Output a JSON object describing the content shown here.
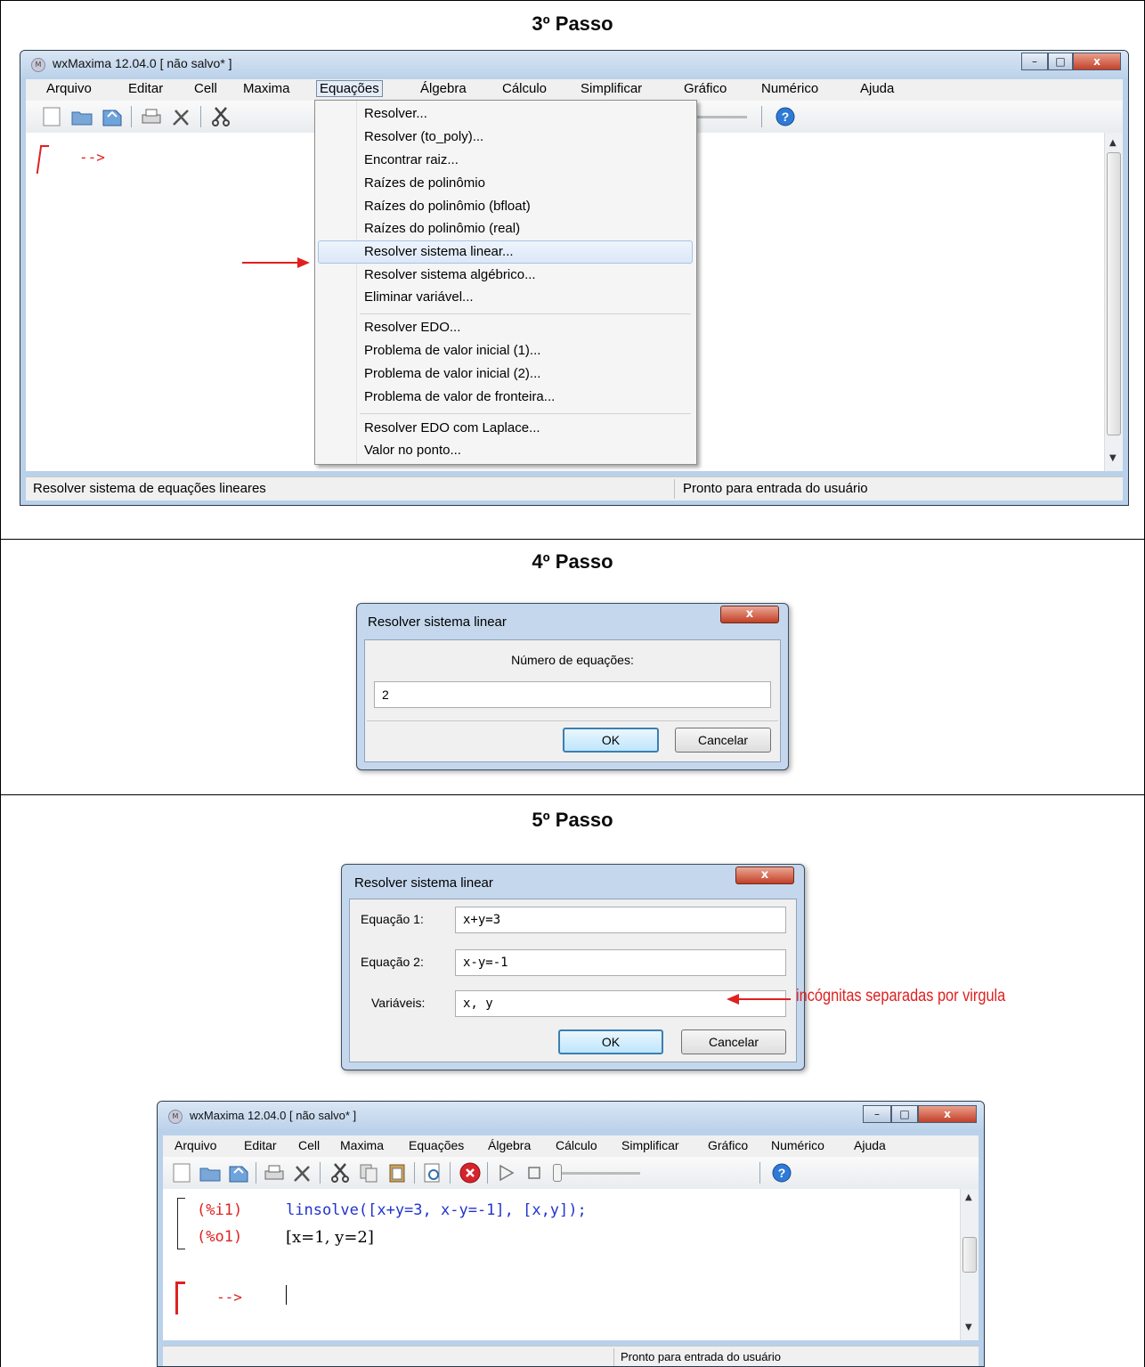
{
  "steps": {
    "step3_title": "3º Passo",
    "step4_title": "4º Passo",
    "step5_title": "5º Passo"
  },
  "window": {
    "title": "wxMaxima 12.04.0 [ não salvo* ]",
    "title_small": "wxMaxima 12.04.0 [ não salvo* ]",
    "app_icon_text": "M",
    "minimize": "–",
    "maximize": "□",
    "close": "x",
    "menu": [
      "Arquivo",
      "Editar",
      "Cell",
      "Maxima",
      "Equações",
      "Álgebra",
      "Cálculo",
      "Simplificar",
      "Gráfico",
      "Numérico",
      "Ajuda"
    ],
    "active_menu": "Equações",
    "input_prompt": "-->"
  },
  "equacoes_menu": {
    "items": [
      "Resolver...",
      "Resolver (to_poly)...",
      "Encontrar raiz...",
      "Raízes de polinômio",
      "Raízes do polinômio (bfloat)",
      "Raízes do polinômio (real)",
      "Resolver sistema linear...",
      "Resolver sistema algébrico...",
      "Eliminar variável...",
      "Resolver EDO...",
      "Problema de valor inicial (1)...",
      "Problema de valor inicial (2)...",
      "Problema de valor de fronteira...",
      "Resolver EDO com Laplace...",
      "Valor no ponto..."
    ],
    "highlighted": "Resolver sistema linear..."
  },
  "status_bar": {
    "left": "Resolver sistema de equações lineares",
    "right": "Pronto para entrada do usuário"
  },
  "dialog_num_eq": {
    "title": "Resolver sistema linear",
    "close": "x",
    "label": "Número de equações:",
    "value": "2",
    "ok": "OK",
    "cancel": "Cancelar"
  },
  "dialog_equations": {
    "title": "Resolver sistema linear",
    "close": "x",
    "eq1_label": "Equação 1:",
    "eq1_value": "x+y=3",
    "eq2_label": "Equação 2:",
    "eq2_value": "x-y=-1",
    "vars_label": "Variáveis:",
    "vars_value": "x, y",
    "ok": "OK",
    "cancel": "Cancelar"
  },
  "annotation": "incógnitas separadas por virgula",
  "result_window": {
    "input_label": "(%i1)",
    "input_code": "linsolve([x+y=3, x-y=-1], [x,y]);",
    "output_label": "(%o1)",
    "output_value": "[x=1, y=2]",
    "prompt": "-->",
    "status": "Pronto para entrada do usuário"
  },
  "colors": {
    "code_blue": "#2233cc",
    "label_red": "#e02020",
    "annotation_red": "#e02020"
  }
}
